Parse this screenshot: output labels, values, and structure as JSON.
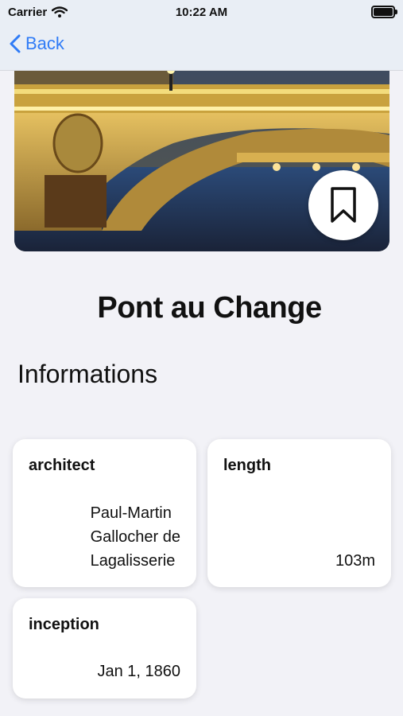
{
  "status_bar": {
    "carrier": "Carrier",
    "time": "10:22 AM"
  },
  "nav": {
    "back_label": "Back"
  },
  "hero": {
    "bookmark_icon": "bookmark-icon"
  },
  "place": {
    "title": "Pont au Change"
  },
  "section": {
    "heading": "Informations"
  },
  "cards": [
    {
      "label": "architect",
      "value_lines": [
        "Paul-Martin",
        "Gallocher de",
        "Lagalisserie"
      ]
    },
    {
      "label": "length",
      "value": "103m"
    },
    {
      "label": "inception",
      "value": "Jan 1, 1860"
    }
  ],
  "colors": {
    "accent": "#2f7bf6",
    "background": "#f2f2f7"
  }
}
